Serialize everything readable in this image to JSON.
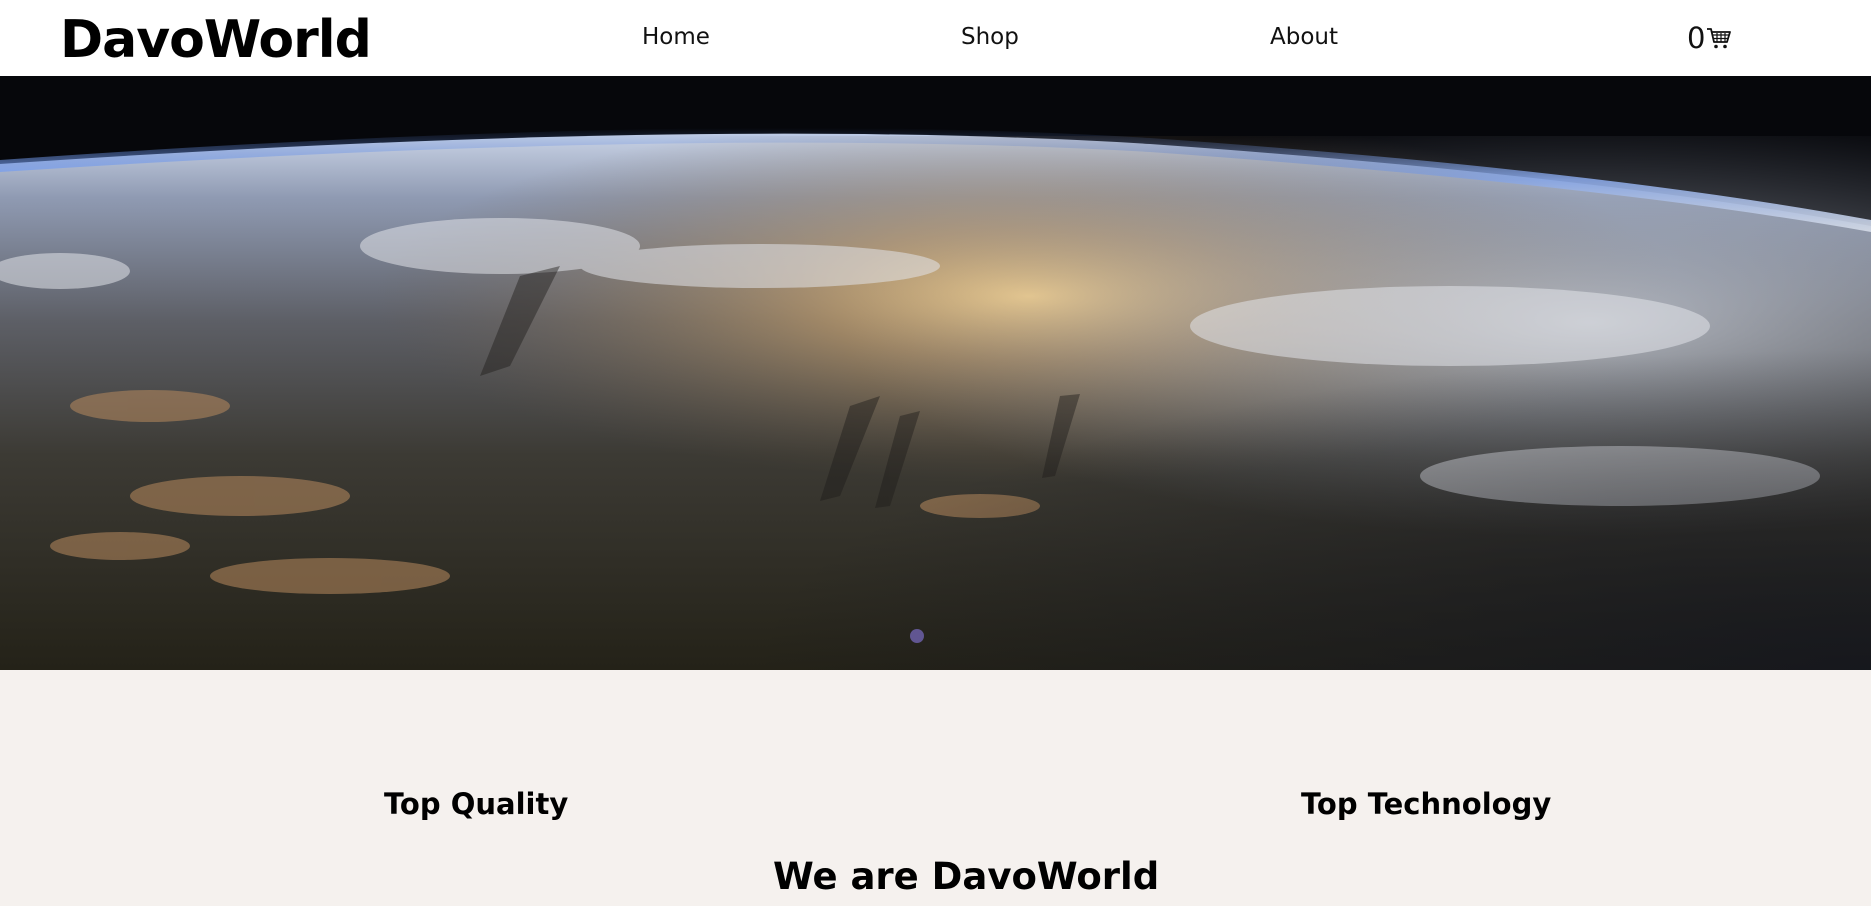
{
  "brand": {
    "name": "DavoWorld"
  },
  "nav": {
    "items": [
      {
        "label": "Home"
      },
      {
        "label": "Shop"
      },
      {
        "label": "About"
      }
    ],
    "cart": {
      "count": "0",
      "icon": "shopping-cart-icon"
    }
  },
  "hero": {
    "image": "earth-from-orbit-photo"
  },
  "features": [
    {
      "title": "Top Quality"
    },
    {
      "title": "Top Technology"
    }
  ],
  "headline": "We are DavoWorld",
  "colors": {
    "nav_bg": "#ffffff",
    "page_bg": "#f5f1ee",
    "text": "#000000"
  }
}
